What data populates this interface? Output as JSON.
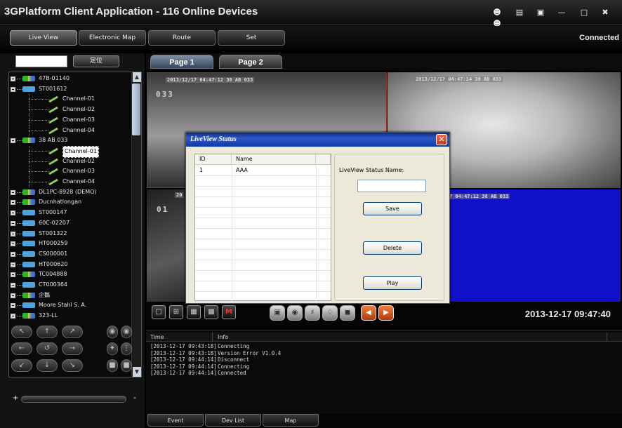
{
  "app": {
    "title": "3GPlatform Client Application - 116 Online Devices"
  },
  "nav": {
    "items": [
      "Live View",
      "Electronic Map",
      "Route",
      "Set"
    ],
    "status": "Connected"
  },
  "sidebar": {
    "locate_label": "定位",
    "search_value": "",
    "tree": [
      {
        "label": "47B-01140",
        "type": "device",
        "status": "online",
        "depth": 0
      },
      {
        "label": "ST001612",
        "type": "device",
        "status": "offline",
        "depth": 0
      },
      {
        "label": "Channel-01",
        "type": "channel",
        "depth": 1
      },
      {
        "label": "Channel-02",
        "type": "channel",
        "depth": 1
      },
      {
        "label": "Channel-03",
        "type": "channel",
        "depth": 1
      },
      {
        "label": "Channel-04",
        "type": "channel",
        "depth": 1
      },
      {
        "label": "38 AB 033",
        "type": "device",
        "status": "online",
        "depth": 0
      },
      {
        "label": "Channel-01",
        "type": "channel",
        "depth": 1,
        "selected": true
      },
      {
        "label": "Channel-02",
        "type": "channel",
        "depth": 1
      },
      {
        "label": "Channel-03",
        "type": "channel",
        "depth": 1
      },
      {
        "label": "Channel-04",
        "type": "channel",
        "depth": 1
      },
      {
        "label": "DL1PC-8928 (DEMO)",
        "type": "device",
        "status": "online",
        "depth": 0
      },
      {
        "label": "Ducnhatlongan",
        "type": "device",
        "status": "online",
        "depth": 0
      },
      {
        "label": "ST000147",
        "type": "device",
        "status": "offline",
        "depth": 0
      },
      {
        "label": "60C-02207",
        "type": "device",
        "status": "offline",
        "depth": 0
      },
      {
        "label": "ST001322",
        "type": "device",
        "status": "offline",
        "depth": 0
      },
      {
        "label": "HT000259",
        "type": "device",
        "status": "offline",
        "depth": 0
      },
      {
        "label": "CS000001",
        "type": "device",
        "status": "offline",
        "depth": 0
      },
      {
        "label": "HT000620",
        "type": "device",
        "status": "offline",
        "depth": 0
      },
      {
        "label": "TC004888",
        "type": "device",
        "status": "online",
        "depth": 0
      },
      {
        "label": "CT000364",
        "type": "device",
        "status": "offline",
        "depth": 0
      },
      {
        "label": "企鵝",
        "type": "device",
        "status": "online",
        "depth": 0
      },
      {
        "label": "Moore Stahl S. A.",
        "type": "device",
        "status": "offline",
        "depth": 0
      },
      {
        "label": "323-LL",
        "type": "device",
        "status": "online",
        "depth": 0
      }
    ]
  },
  "pages": [
    "Page 1",
    "Page 2"
  ],
  "videos": [
    {
      "osd": "2013/12/17 04:47:12  38 AB 033",
      "overlay": "033"
    },
    {
      "osd": "2013/12/17 04:47:14  38 AB 033",
      "overlay": ""
    },
    {
      "osd": "20",
      "overlay": "01"
    },
    {
      "osd": "7 04:47:12  38 AB 033",
      "overlay": ""
    }
  ],
  "toolbar": {
    "datetime": "2013-12-17 09:47:40"
  },
  "log": {
    "columns": [
      "Time",
      "Info"
    ],
    "rows": [
      {
        "time": "[2013-12-17 09:43:18]",
        "info": "Connecting"
      },
      {
        "time": "[2013-12-17 09:43:18]",
        "info": "Version Error V1.0.4"
      },
      {
        "time": "[2013-12-17 09:44:14]",
        "info": "Disconnect"
      },
      {
        "time": "[2013-12-17 09:44:14]",
        "info": "Connecting"
      },
      {
        "time": "[2013-12-17 09:44:14]",
        "info": "Connected"
      }
    ],
    "tabs": [
      "Event",
      "Dev List",
      "Map"
    ]
  },
  "dialog": {
    "title": "LiveView Status",
    "table": {
      "columns": [
        "ID",
        "Name"
      ],
      "rows": [
        {
          "id": "1",
          "name": "AAA"
        }
      ]
    },
    "status_name_label": "LiveView Status Name:",
    "status_name_value": "",
    "save_label": "Save",
    "delete_label": "Delete",
    "play_label": "Play"
  }
}
